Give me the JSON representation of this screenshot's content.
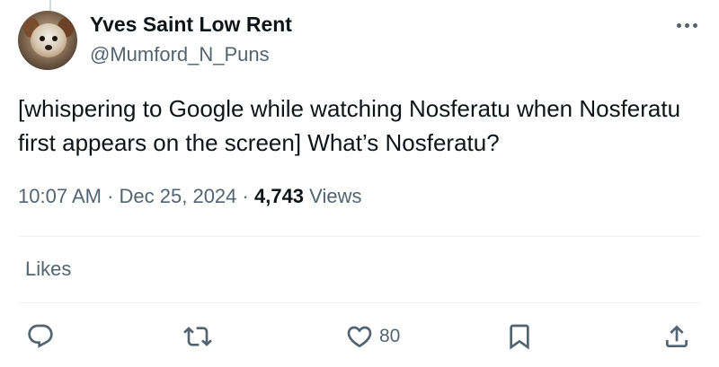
{
  "author": {
    "display_name": "Yves Saint Low Rent",
    "handle": "@Mumford_N_Puns"
  },
  "tweet": {
    "text": "[whispering to Google while watching Nosferatu when Nosferatu first appears on the screen] What’s Nosferatu?",
    "time": "10:07 AM",
    "separator": "·",
    "date": "Dec 25, 2024",
    "views_count": "4,743",
    "views_label": "Views"
  },
  "engagement": {
    "likes_tab_label": "Likes"
  },
  "actions": {
    "reply_icon": "reply-icon",
    "retweet_icon": "retweet-icon",
    "like_icon": "heart-icon",
    "like_count": "80",
    "bookmark_icon": "bookmark-icon",
    "share_icon": "share-icon"
  },
  "colors": {
    "text": "#0f1419",
    "secondary": "#536471",
    "divider": "#eff3f4"
  }
}
